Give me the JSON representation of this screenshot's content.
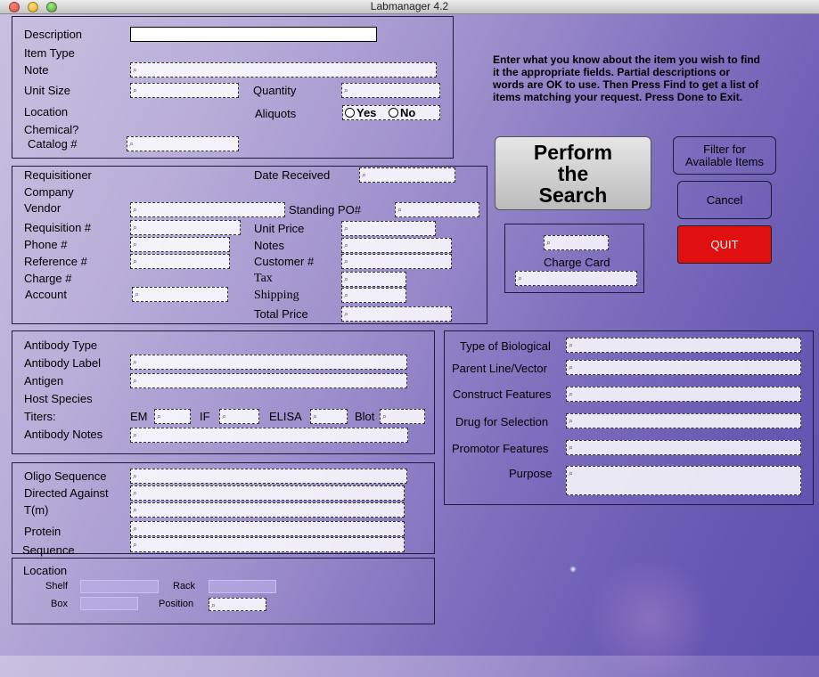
{
  "window": {
    "title": "Labmanager 4.2"
  },
  "colors": {
    "quit_button": "#e00f10",
    "background_accent": "#6a5bb4"
  },
  "item": {
    "description_label": "Description",
    "item_type_label": "Item Type",
    "note_label": "Note",
    "unit_size_label": "Unit Size",
    "quantity_label": "Quantity",
    "location_label": "Location",
    "aliquots_label": "Aliquots",
    "aliquots_yes": "Yes",
    "aliquots_no": "No",
    "chemical_label": "Chemical?",
    "catalog_label": "Catalog #"
  },
  "instructions": "Enter what you know about the item you wish to find it the appropriate fields. Partial descriptions or words are OK to use. Then Press Find to get a list of items matching your request.  Press Done to Exit.",
  "buttons": {
    "perform_search": "Perform the Search",
    "filter": "Filter for Available Items",
    "cancel": "Cancel",
    "quit": "QUIT"
  },
  "charge_card": {
    "label": "Charge Card"
  },
  "order": {
    "requisitioner_label": "Requisitioner",
    "date_received_label": "Date Received",
    "company_label": "Company",
    "vendor_label": "Vendor",
    "standing_po_label": "Standing PO#",
    "requisition_label": "Requisition #",
    "unit_price_label": "Unit Price",
    "phone_label": "Phone #",
    "notes_label": "Notes",
    "reference_label": "Reference #",
    "customer_label": "Customer #",
    "charge_label": "Charge #",
    "tax_label": "Tax",
    "account_label": "Account",
    "shipping_label": "Shipping",
    "total_price_label": "Total Price"
  },
  "antibody": {
    "type_label": "Antibody Type",
    "label_label": "Antibody Label",
    "antigen_label": "Antigen",
    "host_species_label": "Host Species",
    "titers_label": "Titers:",
    "em_label": "EM",
    "if_label": "IF",
    "elisa_label": "ELISA",
    "blot_label": "Blot",
    "notes_label": "Antibody Notes"
  },
  "biological": {
    "type_label": "Type of Biological",
    "parent_line_label": "Parent Line/Vector",
    "construct_label": "Construct Features",
    "drug_label": "Drug for Selection",
    "promotor_label": "Promotor Features",
    "purpose_label": "Purpose"
  },
  "oligo": {
    "sequence_label": "Oligo Sequence",
    "directed_label": "Directed Against",
    "tm_label": "T(m)",
    "protein_label": "Protein",
    "sequence2_label": "Sequence"
  },
  "storage": {
    "location_label": "Location",
    "shelf_label": "Shelf",
    "rack_label": "Rack",
    "box_label": "Box",
    "position_label": "Position"
  }
}
